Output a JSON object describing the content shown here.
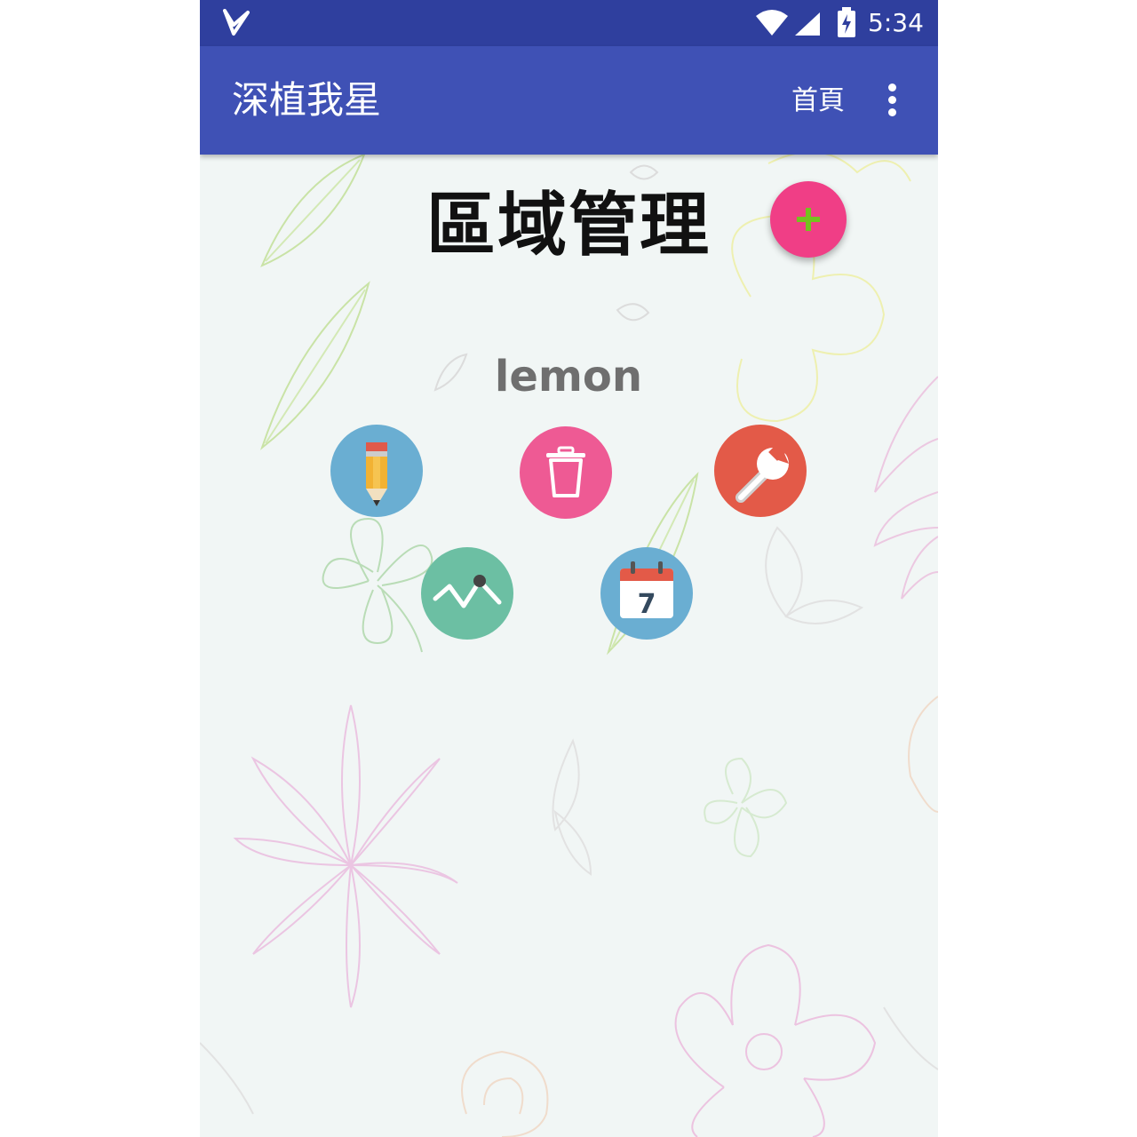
{
  "status_bar": {
    "time": "5:34",
    "icons": [
      "app-notification-icon",
      "wifi-icon",
      "signal-icon",
      "battery-icon"
    ]
  },
  "app_bar": {
    "title": "深植我星",
    "home_action": "首頁",
    "overflow_icon": "more-vert-icon",
    "color": "#3f51b5",
    "status_color": "#2f3f9e"
  },
  "page": {
    "heading": "區域管理",
    "add_button_icon": "plus-icon",
    "add_button_color": "#f03e86"
  },
  "area": {
    "name": "lemon",
    "actions": [
      {
        "name": "edit",
        "icon": "pencil-icon",
        "color": "#6aaed2"
      },
      {
        "name": "delete",
        "icon": "trash-icon",
        "color": "#ee5a94"
      },
      {
        "name": "settings",
        "icon": "wrench-icon",
        "color": "#e35a48"
      },
      {
        "name": "chart",
        "icon": "line-chart-icon",
        "color": "#6cbfa3"
      },
      {
        "name": "calendar",
        "icon": "calendar-icon",
        "calendar_day": "7",
        "color": "#6aaed2"
      }
    ]
  }
}
